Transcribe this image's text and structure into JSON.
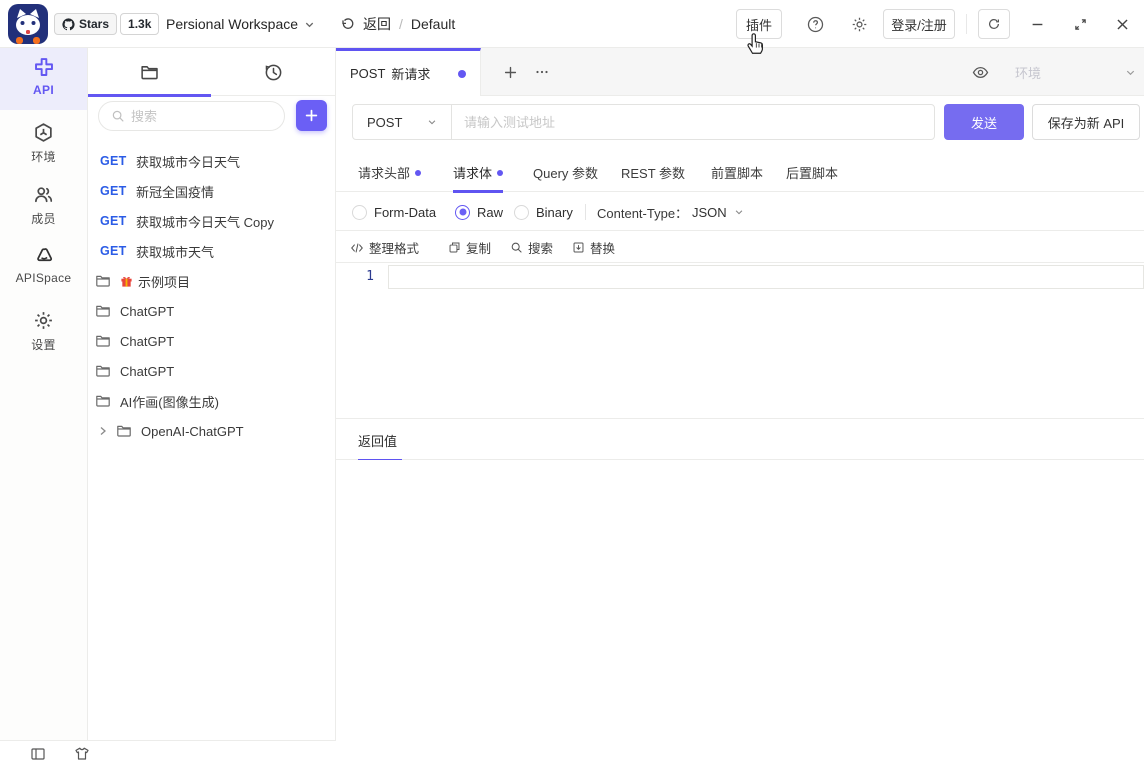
{
  "topbar": {
    "github": {
      "stars_label": "Stars",
      "stars_count": "1.3k"
    },
    "workspace": "Persional Workspace",
    "back_label": "返回",
    "breadcrumb_sep": "/",
    "breadcrumb_current": "Default",
    "plugin_button": "插件",
    "login_button": "登录/注册"
  },
  "nav": {
    "items": [
      {
        "label": "API"
      },
      {
        "label": "环境"
      },
      {
        "label": "成员"
      },
      {
        "label": "APISpace"
      },
      {
        "label": "设置"
      }
    ]
  },
  "sidebar": {
    "search_placeholder": "搜索",
    "items": [
      {
        "type": "request",
        "method": "GET",
        "label": "获取城市今日天气"
      },
      {
        "type": "request",
        "method": "GET",
        "label": "新冠全国疫情"
      },
      {
        "type": "request",
        "method": "GET",
        "label": "获取城市今日天气 Copy"
      },
      {
        "type": "request",
        "method": "GET",
        "label": "获取城市天气"
      },
      {
        "type": "folder-gift",
        "label": "示例项目"
      },
      {
        "type": "folder",
        "label": "ChatGPT"
      },
      {
        "type": "folder",
        "label": "ChatGPT"
      },
      {
        "type": "folder",
        "label": "ChatGPT"
      },
      {
        "type": "folder",
        "label": "AI作画(图像生成)"
      },
      {
        "type": "folder-expandable",
        "label": "OpenAI-ChatGPT"
      }
    ]
  },
  "main": {
    "tab": {
      "method": "POST",
      "name": "新请求"
    },
    "env_selector": "环境",
    "request": {
      "method": "POST",
      "url_placeholder": "请输入测试地址",
      "send_button": "发送",
      "save_button": "保存为新 API"
    },
    "req_tabs": [
      {
        "label": "请求头部"
      },
      {
        "label": "请求体"
      },
      {
        "label": "Query 参数"
      },
      {
        "label": "REST 参数"
      },
      {
        "label": "前置脚本"
      },
      {
        "label": "后置脚本"
      }
    ],
    "body": {
      "modes": [
        {
          "label": "Form-Data"
        },
        {
          "label": "Raw"
        },
        {
          "label": "Binary"
        }
      ],
      "selected_mode": "Raw",
      "content_type_label": "Content-Type：",
      "content_type_value": "JSON",
      "toolbar": [
        {
          "label": "整理格式"
        },
        {
          "label": "复制"
        },
        {
          "label": "搜索"
        },
        {
          "label": "替换"
        }
      ],
      "editor_line_number": "1"
    },
    "response": {
      "title": "返回值"
    }
  },
  "colors": {
    "accent": "#6357f2",
    "send_button": "#766cf0",
    "get_method": "#2b5ce6",
    "logo_navy": "#22307a",
    "logo_orange": "#f5701e"
  }
}
